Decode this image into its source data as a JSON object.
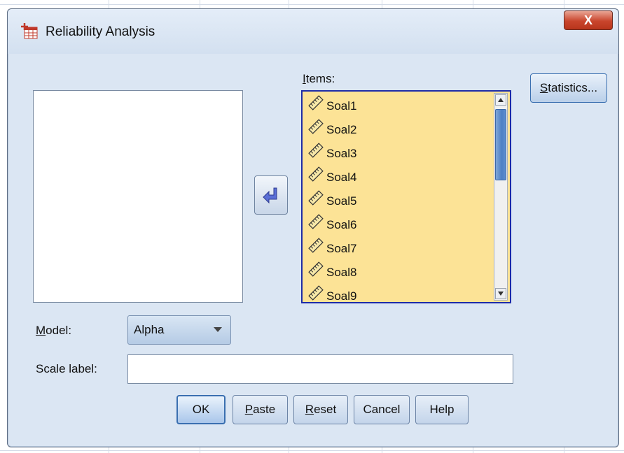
{
  "window": {
    "title": "Reliability Analysis",
    "close_label": "X"
  },
  "items_panel": {
    "label_underlined": "I",
    "label_rest": "tems:",
    "items": [
      "Soal1",
      "Soal2",
      "Soal3",
      "Soal4",
      "Soal5",
      "Soal6",
      "Soal7",
      "Soal8",
      "Soal9"
    ]
  },
  "buttons": {
    "statistics_underlined": "S",
    "statistics_rest": "tatistics...",
    "ok": "OK",
    "paste_underlined": "P",
    "paste_rest": "aste",
    "reset_underlined": "R",
    "reset_rest": "eset",
    "cancel": "Cancel",
    "help": "Help"
  },
  "model": {
    "label_underlined": "M",
    "label_rest": "odel:",
    "selected": "Alpha"
  },
  "scale": {
    "label": "Scale label:",
    "value": ""
  },
  "colors": {
    "dialog_bg": "#dbe6f3",
    "items_bg": "#fce396",
    "items_border": "#1e2ca8",
    "close_red": "#c9452c"
  }
}
